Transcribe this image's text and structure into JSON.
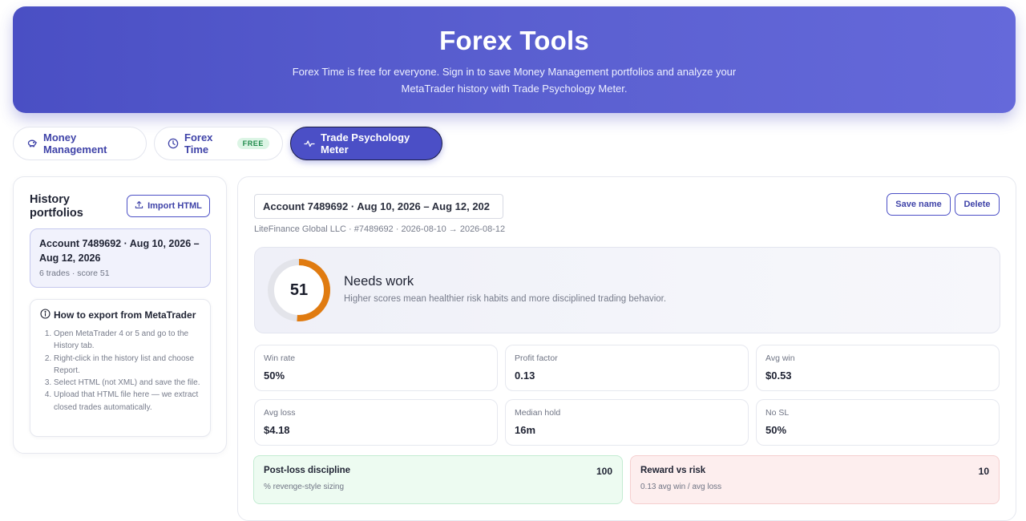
{
  "header": {
    "title": "Forex Tools",
    "subtitle": "Forex Time is free for everyone. Sign in to save Money Management portfolios and analyze your MetaTrader history with Trade Psychology Meter."
  },
  "tabs": [
    {
      "label": "Money Management",
      "icon": "piggy-bank-icon",
      "active": false
    },
    {
      "label": "Forex Time",
      "icon": "clock-icon",
      "badge": "FREE",
      "active": false
    },
    {
      "label": "Trade Psychology Meter",
      "icon": "pulse-icon",
      "active": true
    }
  ],
  "sidebar": {
    "title": "History portfolios",
    "import_label": "Import HTML",
    "portfolio": {
      "title": "Account 7489692 · Aug 10, 2026 – Aug 12, 2026",
      "subtitle": "6 trades · score 51"
    },
    "howto": {
      "title": "How to export from MetaTrader",
      "steps": [
        "Open MetaTrader 4 or 5 and go to the History tab.",
        "Right-click in the history list and choose Report.",
        "Select HTML (not XML) and save the file.",
        "Upload that HTML file here — we extract closed trades automatically."
      ]
    }
  },
  "main": {
    "account_name": "Account 7489692 · Aug 10, 2026 – Aug 12, 202",
    "account_meta": "LiteFinance Global LLC · #7489692 · 2026-08-10 → 2026-08-12",
    "save_label": "Save name",
    "delete_label": "Delete",
    "score": {
      "value": "51",
      "level": 0.51,
      "title": "Needs work",
      "subtitle": "Higher scores mean healthier risk habits and more disciplined trading behavior.",
      "ring_color": "#e07b10",
      "track_color": "#e3e4ea"
    },
    "stats": [
      {
        "label": "Win rate",
        "value": "50%"
      },
      {
        "label": "Profit factor",
        "value": "0.13"
      },
      {
        "label": "Avg win",
        "value": "$0.53"
      },
      {
        "label": "Avg loss",
        "value": "$4.18"
      },
      {
        "label": "Median hold",
        "value": "16m"
      },
      {
        "label": "No SL",
        "value": "50%"
      }
    ],
    "metrics": [
      {
        "title": "Post-loss discipline",
        "value": "100",
        "desc": "% revenge-style sizing",
        "status": "good"
      },
      {
        "title": "Reward vs risk",
        "value": "10",
        "desc": "0.13 avg win / avg loss",
        "status": "bad"
      }
    ]
  }
}
